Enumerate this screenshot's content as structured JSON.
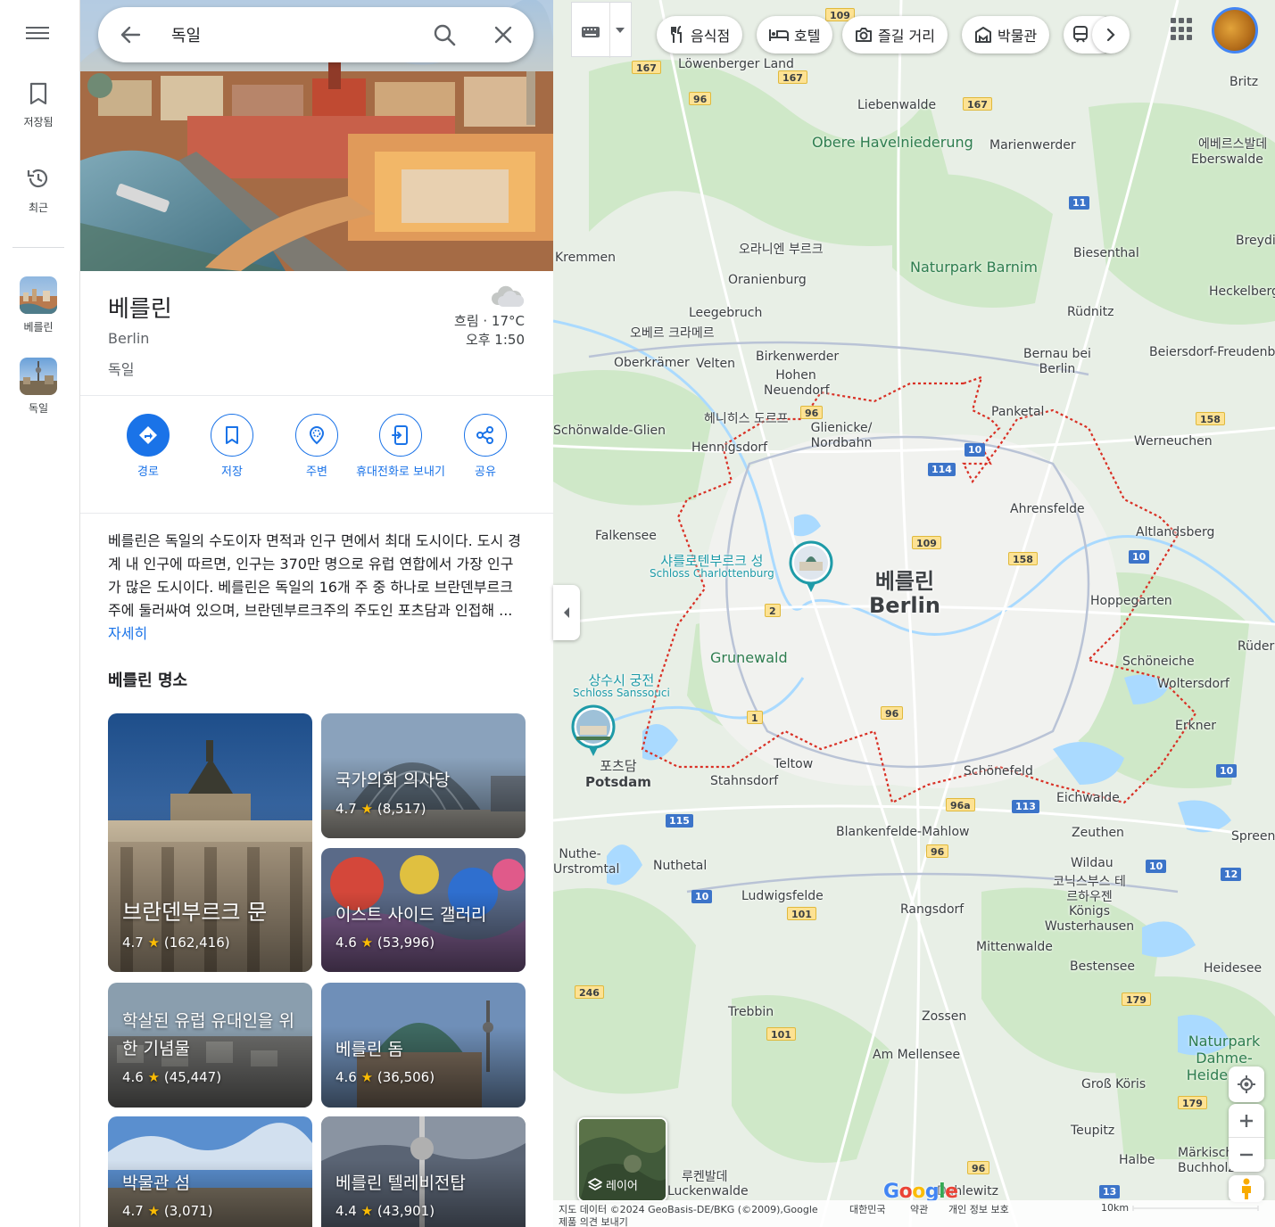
{
  "rail": {
    "saved_label": "저장됨",
    "recent_label": "최근",
    "history": [
      {
        "label": "베를린"
      },
      {
        "label": "독일"
      }
    ]
  },
  "search": {
    "value": "독일",
    "placeholder": ""
  },
  "place": {
    "title": "베를린",
    "subtitle": "Berlin",
    "country": "독일",
    "weather_condition": "흐림 · 17°C",
    "local_time": "오후 1:50"
  },
  "actions": [
    {
      "label": "경로",
      "icon": "directions-icon"
    },
    {
      "label": "저장",
      "icon": "bookmark-icon"
    },
    {
      "label": "주변",
      "icon": "nearby-icon"
    },
    {
      "label": "휴대전화로 보내기",
      "icon": "send-to-phone-icon"
    },
    {
      "label": "공유",
      "icon": "share-icon"
    }
  ],
  "description": {
    "text": "베를린은 독일의 수도이자 면적과 인구 면에서 최대 도시이다. 도시 경계 내 인구에 따르면, 인구는 370만 명으로 유럽 연합에서 가장 인구가 많은 도시이다. 베를린은 독일의 16개 주 중 하나로 브란덴부르크주에 둘러싸여 있으며, 브란덴부르크주의 주도인 포츠담과 인접해 ...",
    "more_link": "자세히"
  },
  "attractions": {
    "heading": "베를린 명소",
    "items": [
      {
        "name": "브란덴부르크 문",
        "rating": "4.7",
        "reviews": "(162,416)"
      },
      {
        "name": "국가의회 의사당",
        "rating": "4.7",
        "reviews": "(8,517)"
      },
      {
        "name": "이스트 사이드 갤러리",
        "rating": "4.6",
        "reviews": "(53,996)"
      },
      {
        "name": "학살된 유럽 유대인을 위한 기념물",
        "rating": "4.6",
        "reviews": "(45,447)"
      },
      {
        "name": "베를린 돔",
        "rating": "4.6",
        "reviews": "(36,506)"
      },
      {
        "name": "박물관 섬",
        "rating": "4.7",
        "reviews": "(3,071)"
      },
      {
        "name": "베를린 텔레비전탑",
        "rating": "4.4",
        "reviews": "(43,901)"
      }
    ]
  },
  "map": {
    "chips": [
      {
        "label": "음식점",
        "icon": "restaurant-icon"
      },
      {
        "label": "호텔",
        "icon": "hotel-icon"
      },
      {
        "label": "즐길 거리",
        "icon": "camera-icon"
      },
      {
        "label": "박물관",
        "icon": "museum-icon"
      }
    ],
    "city_label_ko": "베를린",
    "city_label_en": "Berlin",
    "pois": [
      {
        "ko": "샤를로텐부르크 성",
        "en": "Schloss Charlottenburg"
      },
      {
        "ko": "상수시 궁전",
        "en": "Schloss Sanssouci"
      }
    ],
    "potsdam": {
      "ko": "포츠담",
      "en": "Potsdam"
    },
    "towns": [
      "Löwenberger Land",
      "Liebenwalde",
      "Marienwerder",
      "Britz",
      "에베르스발데",
      "Eberswalde",
      "Kremmen",
      "오라니엔 부르크",
      "Oranienburg",
      "Biesenthal",
      "Breydin",
      "Heckelberg",
      "Leegebruch",
      "Rüdnitz",
      "오베르 크라메르",
      "Oberkrämer",
      "Velten",
      "Birkenwerder",
      "Hohen Neuendorf",
      "Bernau bei Berlin",
      "Beiersdorf-Freudenberg",
      "Panketal",
      "헤니히스 도르프",
      "Hennigsdorf",
      "Glienicke/ Nordbahn",
      "Schönwalde-Glien",
      "Werneuchen",
      "Falkensee",
      "Ahrensfelde",
      "Altlandsberg",
      "Hoppegarten",
      "Rüdersdorf",
      "Schöneiche",
      "Woltersdorf",
      "Erkner",
      "Teltow",
      "Stahnsdorf",
      "Schönefeld",
      "Eichwalde",
      "Zeuthen",
      "Blankenfelde-Mahlow",
      "Nuthetal",
      "Wildau",
      "코닉스부스 테르하우젠",
      "Königs Wusterhausen",
      "Ludwigsfelde",
      "Rangsdorf",
      "Mittenwalde",
      "Bestensee",
      "Heidesee",
      "Trebbin",
      "Zossen",
      "Am Mellensee",
      "Groß Köris",
      "Teupitz",
      "Halbe",
      "Märkisch Buchholz",
      "루켄발데",
      "Luckenwalde",
      "Dahlewitz",
      "Spreenhagen",
      "Nuthe-Urstromtal"
    ],
    "greens": [
      "Obere Havelniederung",
      "Naturpark Barnim",
      "Grunewald",
      "Naturpark Dahme-Heideseen"
    ],
    "layer_label": "레이어",
    "footer": {
      "attribution": "지도 데이터 ©2024 GeoBasis-DE/BKG (©2009),Google",
      "country": "대한민국",
      "terms": "약관",
      "privacy": "개인 정보 보호",
      "feedback": "제품 의견 보내기",
      "scale": "10km"
    }
  },
  "colors": {
    "accent": "#1a73e8",
    "boundary": "#d93025",
    "star": "#fbbc04",
    "map_green": "#cfe8c8",
    "map_base": "#e8efe6"
  }
}
